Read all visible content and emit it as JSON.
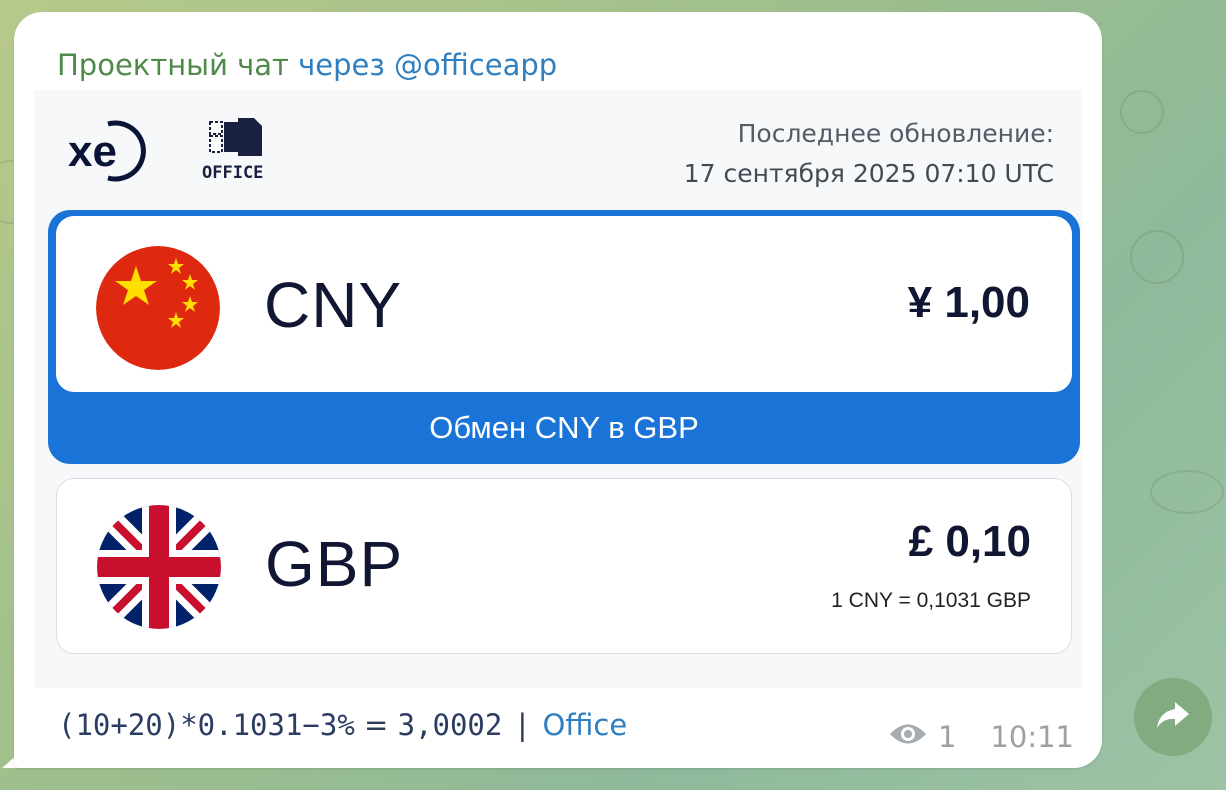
{
  "message": {
    "via_prefix": "Проектный чат",
    "via_bot": "через @officeapp"
  },
  "card": {
    "logos": {
      "xe_text": "xe",
      "office_text": "OFFICE"
    },
    "updated_label": "Последнее обновление:",
    "updated_value": "17 сентября 2025 07:10 UTC",
    "from": {
      "code": "CNY",
      "amount": "¥ 1,00",
      "flag_icon": "china-flag-icon"
    },
    "exchange_button_label": "Обмен CNY в GBP",
    "to": {
      "code": "GBP",
      "amount": "£ 0,10",
      "rate": "1 CNY = 0,1031 GBP",
      "flag_icon": "uk-flag-icon"
    },
    "colors": {
      "accent_blue": "#1a73d6",
      "text_dark": "#111733"
    }
  },
  "footer": {
    "formula": "(10+20)*0.1031−3%",
    "equals": "=",
    "result": "3,0002",
    "separator": "|",
    "link_text": "Office",
    "views": "1",
    "time": "10:11"
  }
}
